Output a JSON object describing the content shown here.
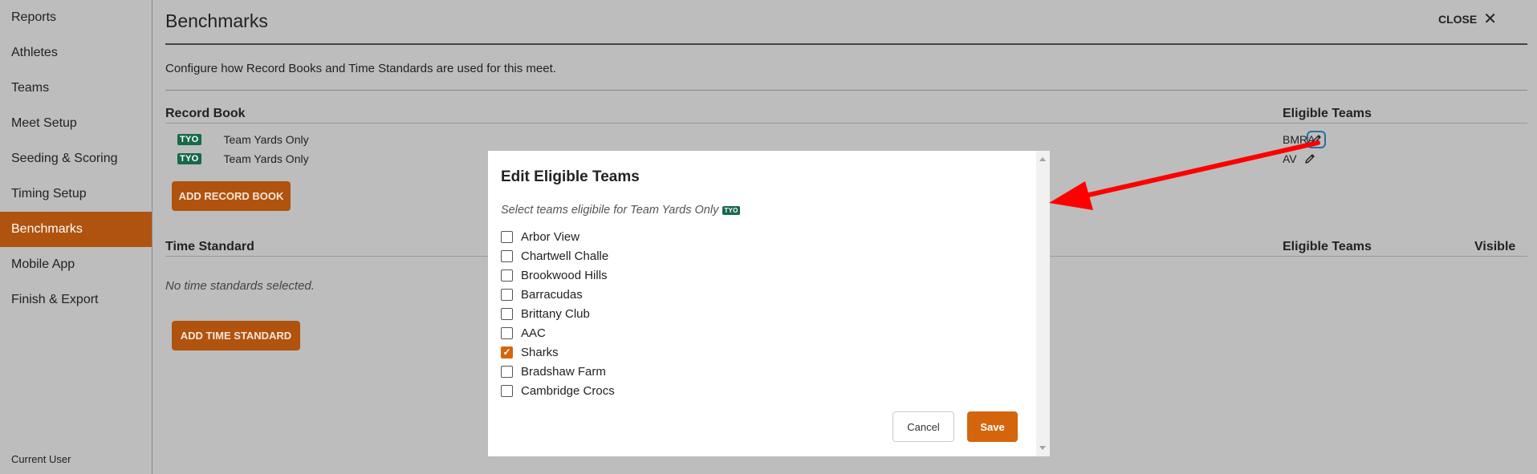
{
  "sidebar": {
    "items": [
      {
        "label": "Reports"
      },
      {
        "label": "Athletes"
      },
      {
        "label": "Teams"
      },
      {
        "label": "Meet Setup"
      },
      {
        "label": "Seeding & Scoring"
      },
      {
        "label": "Timing Setup"
      },
      {
        "label": "Benchmarks",
        "active": true
      },
      {
        "label": "Mobile App"
      },
      {
        "label": "Finish & Export"
      }
    ],
    "current_user_label": "Current User"
  },
  "header": {
    "title": "Benchmarks",
    "close_label": "CLOSE",
    "close_icon": "close-icon"
  },
  "description": "Configure how Record Books and Time Standards are used for this meet.",
  "record_book": {
    "heading": "Record Book",
    "eligible_heading": "Eligible Teams",
    "rows": [
      {
        "badge": "TYO",
        "name": "Team Yards Only",
        "eligible": "BMRA"
      },
      {
        "badge": "TYO",
        "name": "Team Yards Only",
        "eligible": "AV"
      }
    ],
    "add_label": "ADD RECORD BOOK"
  },
  "time_standard": {
    "heading": "Time Standard",
    "eligible_heading": "Eligible Teams",
    "visible_heading": "Visible",
    "empty_text": "No time standards selected.",
    "add_label": "ADD TIME STANDARD"
  },
  "modal": {
    "title": "Edit Eligible Teams",
    "subtitle": "Select teams eligibile for Team Yards Only",
    "subtitle_badge": "TYO",
    "teams": [
      {
        "name": "Arbor View",
        "checked": false
      },
      {
        "name": "Chartwell Challe",
        "checked": false
      },
      {
        "name": "Brookwood Hills",
        "checked": false
      },
      {
        "name": "Barracudas",
        "checked": false
      },
      {
        "name": "Brittany Club",
        "checked": false
      },
      {
        "name": "AAC",
        "checked": false
      },
      {
        "name": "Sharks",
        "checked": true
      },
      {
        "name": "Bradshaw Farm",
        "checked": false
      },
      {
        "name": "Cambridge Crocs",
        "checked": false
      }
    ],
    "cancel_label": "Cancel",
    "save_label": "Save"
  },
  "colors": {
    "accent": "#b0530e",
    "save": "#d4650d",
    "badge": "#17694a",
    "annotation_arrow": "#ff0000"
  }
}
